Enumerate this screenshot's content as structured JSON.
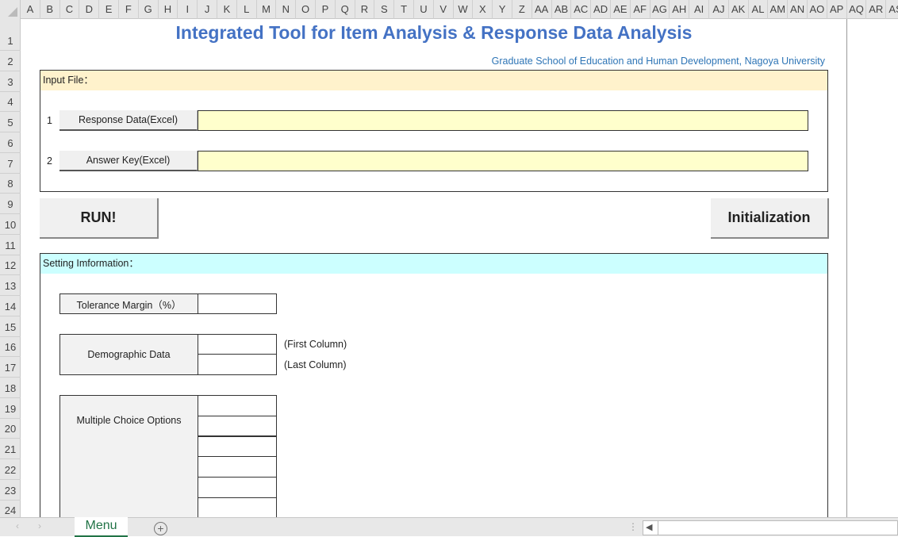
{
  "spreadsheet": {
    "columns": [
      "A",
      "B",
      "C",
      "D",
      "E",
      "F",
      "G",
      "H",
      "I",
      "J",
      "K",
      "L",
      "M",
      "N",
      "O",
      "P",
      "Q",
      "R",
      "S",
      "T",
      "U",
      "V",
      "W",
      "X",
      "Y",
      "Z",
      "AA",
      "AB",
      "AC",
      "AD",
      "AE",
      "AF",
      "AG",
      "AH",
      "AI",
      "AJ",
      "AK",
      "AL",
      "AM",
      "AN",
      "AO",
      "AP",
      "AQ",
      "AR",
      "AS"
    ],
    "rows": [
      "1",
      "2",
      "3",
      "4",
      "5",
      "6",
      "7",
      "8",
      "9",
      "10",
      "11",
      "12",
      "13",
      "14",
      "15",
      "16",
      "17",
      "18",
      "19",
      "20",
      "21",
      "22",
      "23",
      "24"
    ]
  },
  "header": {
    "title": "Integrated Tool for Item Analysis & Response Data Analysis",
    "subtitle": "Graduate School of Education and Human Development, Nagoya University"
  },
  "input_file": {
    "heading": "Input File：",
    "items": [
      {
        "num": "1",
        "button": "Response Data(Excel)",
        "value": ""
      },
      {
        "num": "2",
        "button": "Answer Key(Excel)",
        "value": ""
      }
    ]
  },
  "actions": {
    "run": "RUN!",
    "init": "Initialization"
  },
  "settings": {
    "heading": "Setting Imformation：",
    "tolerance_label": "Tolerance Margin（%）",
    "demographic_label": "Demographic Data",
    "first_column": "(First Column)",
    "last_column": "(Last Column)",
    "mc_label": "Multiple Choice Options"
  },
  "tabs": {
    "active": "Menu",
    "add_icon": "plus-circle-icon"
  },
  "colors": {
    "title": "#4472c4",
    "input_band": "#fff2cc",
    "setting_band": "#ccffff",
    "field": "#ffffcc",
    "tab_text": "#217346"
  }
}
